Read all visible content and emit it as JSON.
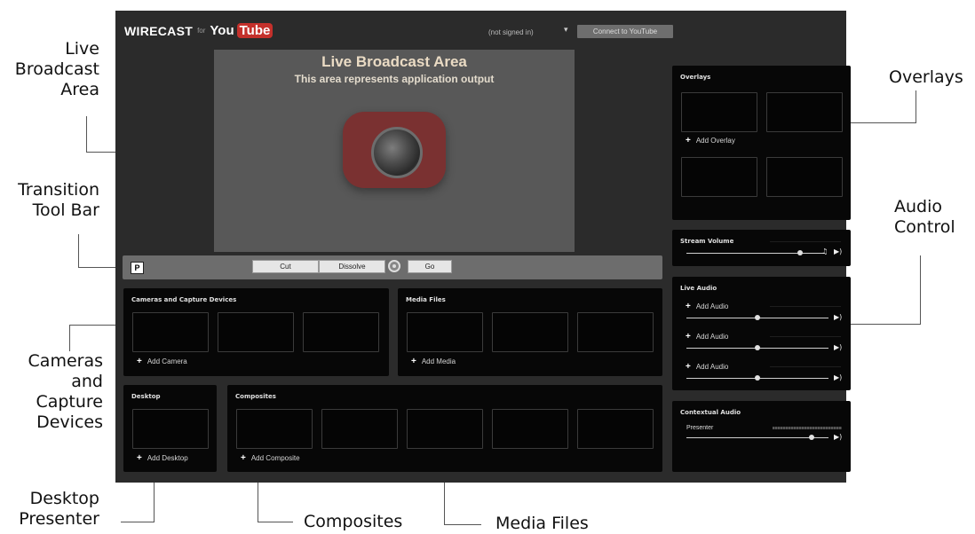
{
  "app": {
    "logo_wirecast": "WIRECAST",
    "logo_for": "for",
    "logo_you": "You",
    "logo_tube": "Tube",
    "signin_status": "(not signed in)",
    "connect_button": "Connect to YouTube"
  },
  "live_area": {
    "title": "Live Broadcast Area",
    "subtitle": "This area represents application output"
  },
  "transition": {
    "p_label": "P",
    "cut": "Cut",
    "dissolve": "Dissolve",
    "go": "Go"
  },
  "cameras": {
    "title": "Cameras and Capture Devices",
    "add": "Add Camera"
  },
  "media": {
    "title": "Media Files",
    "add": "Add Media"
  },
  "desktop": {
    "title": "Desktop",
    "add": "Add Desktop"
  },
  "composites": {
    "title": "Composites",
    "add": "Add Composite"
  },
  "overlays": {
    "title": "Overlays",
    "add": "Add Overlay"
  },
  "stream_volume": {
    "title": "Stream Volume",
    "level": 0.82
  },
  "live_audio": {
    "title": "Live Audio",
    "rows": [
      {
        "add": "Add Audio",
        "level": 0.5
      },
      {
        "add": "Add Audio",
        "level": 0.5
      },
      {
        "add": "Add Audio",
        "level": 0.5
      }
    ]
  },
  "contextual_audio": {
    "title": "Contextual Audio",
    "presenter": "Presenter",
    "level": 0.88
  },
  "callouts": {
    "live_broadcast": [
      "Live",
      "Broadcast",
      "Area"
    ],
    "transition": [
      "Transition",
      "Tool Bar"
    ],
    "cameras": [
      "Cameras",
      "and",
      "Capture",
      "Devices"
    ],
    "desktop": [
      "Desktop",
      "Presenter"
    ],
    "composites": "Composites",
    "media_files": "Media Files",
    "overlays": "Overlays",
    "audio": [
      "Audio",
      "Control"
    ]
  },
  "colors": {
    "app_bg": "#2b2b2b",
    "panel_bg": "#070707",
    "youtube_red": "#c4302b",
    "live_area_bg": "#585858"
  }
}
